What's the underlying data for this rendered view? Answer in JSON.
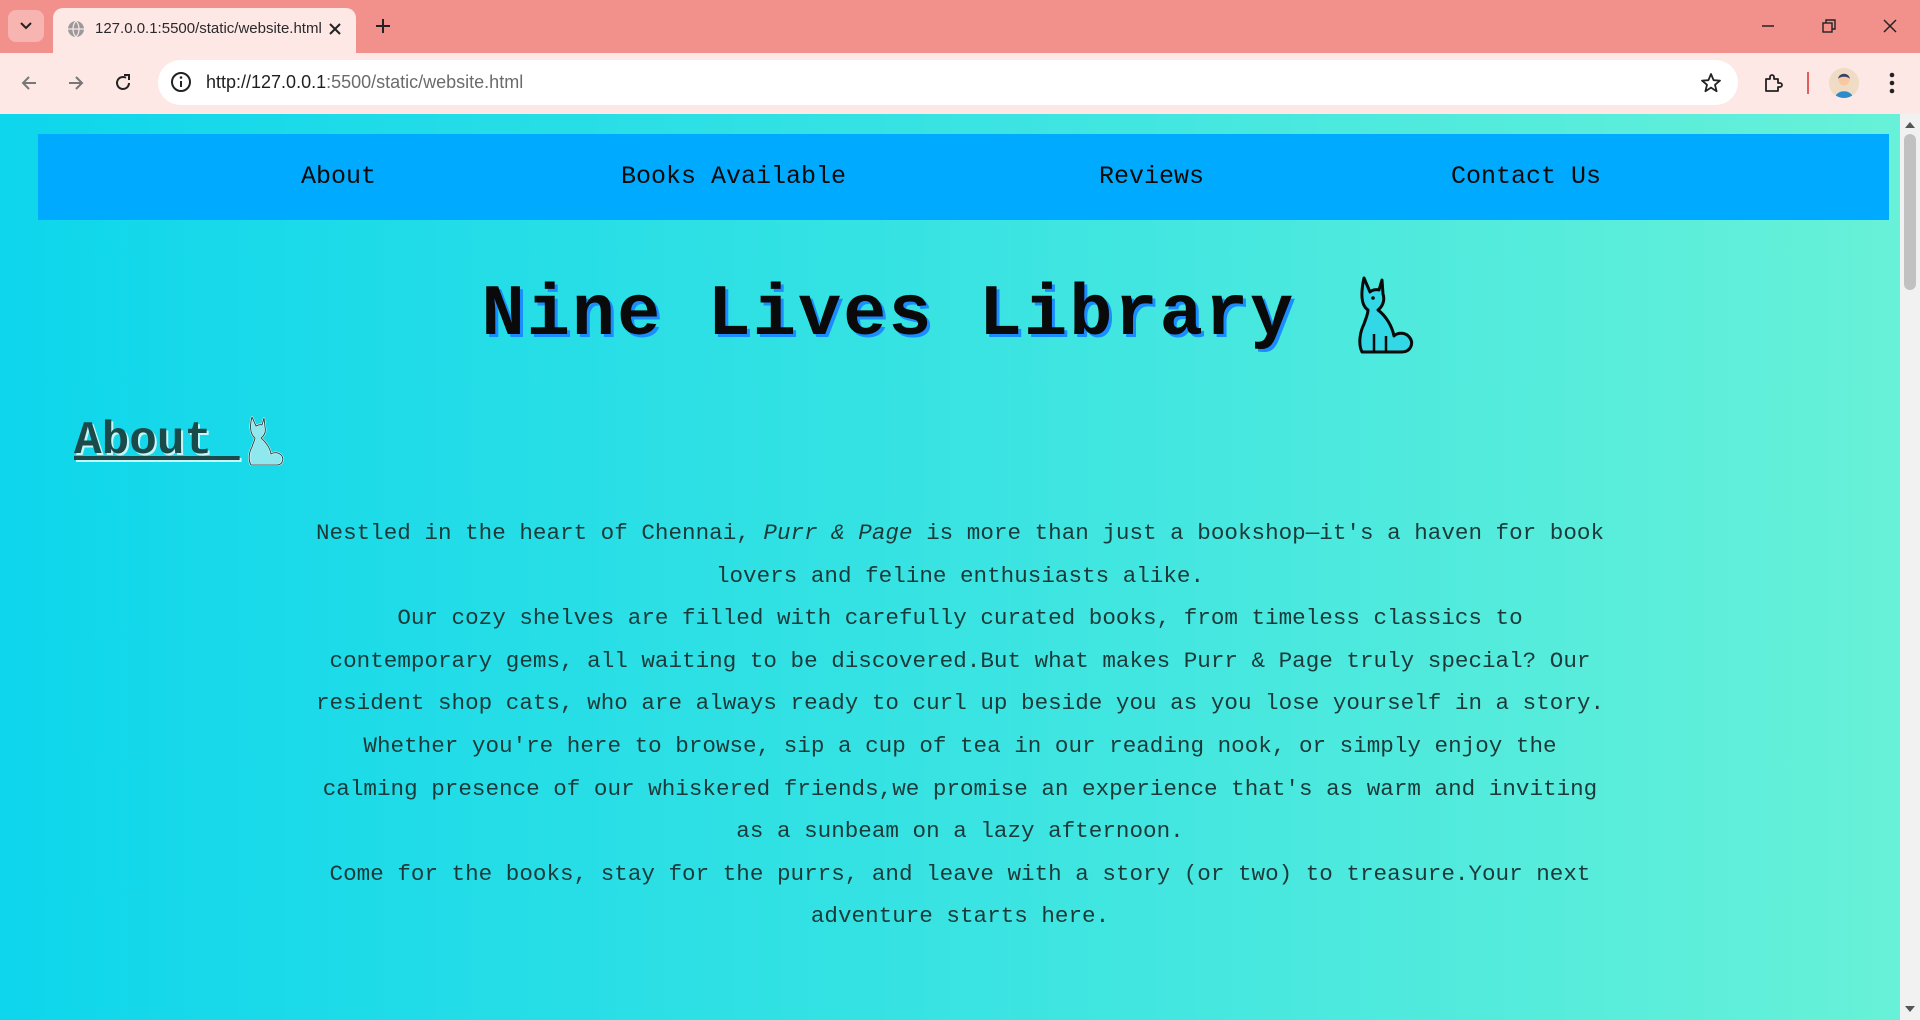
{
  "browser": {
    "tab_title": "127.0.0.1:5500/static/website.html",
    "url_host": "http://127.0.0.1",
    "url_rest": ":5500/static/website.html"
  },
  "nav": {
    "items": [
      {
        "label": "About"
      },
      {
        "label": "Books Available"
      },
      {
        "label": "Reviews"
      },
      {
        "label": "Contact Us"
      }
    ]
  },
  "header": {
    "title": "Nine Lives Library"
  },
  "about": {
    "heading": "About",
    "p1_before": "Nestled in the heart of Chennai, ",
    "p1_emph": "Purr & Page",
    "p1_after": " is more than just a bookshop—it's a haven for book lovers and feline enthusiasts alike.",
    "p2": "Our cozy shelves are filled with carefully curated books, from timeless classics to contemporary gems, all waiting to be discovered.But what makes Purr & Page truly special? Our resident shop cats, who are always ready to curl up beside you as you lose yourself in a story.",
    "p3": "Whether you're here to browse, sip a cup of tea in our reading nook, or simply enjoy the calming presence of our whiskered friends,we promise an experience that's as warm and inviting as a sunbeam on a lazy afternoon.",
    "p4": "Come for the books, stay for the purrs, and leave with a story (or two) to treasure.Your next adventure starts here."
  },
  "icons": {
    "title_icon": "cat-icon",
    "heading_icon": "cat-icon"
  },
  "colors": {
    "tabbar": "#f2908c",
    "toolbar": "#fde8e6",
    "nav_bg": "#00aaff",
    "gradient_start": "#0ed6ec",
    "gradient_end": "#67f1d8"
  }
}
